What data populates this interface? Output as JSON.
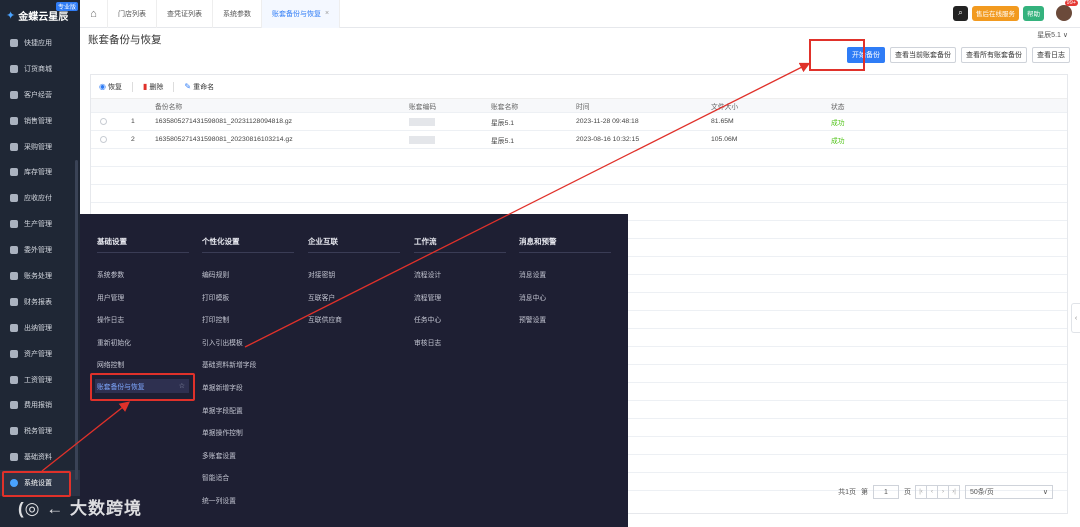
{
  "brand": {
    "name": "金蝶云星辰",
    "badge": "专业版"
  },
  "sidebar": {
    "items": [
      {
        "label": "快捷应用"
      },
      {
        "label": "订货商城"
      },
      {
        "label": "客户经营"
      },
      {
        "label": "销售管理"
      },
      {
        "label": "采购管理"
      },
      {
        "label": "库存管理"
      },
      {
        "label": "应收应付"
      },
      {
        "label": "生产管理"
      },
      {
        "label": "委外管理"
      },
      {
        "label": "账务处理"
      },
      {
        "label": "财务报表"
      },
      {
        "label": "出纳管理"
      },
      {
        "label": "资产管理"
      },
      {
        "label": "工资管理"
      },
      {
        "label": "费用报销"
      },
      {
        "label": "税务管理"
      },
      {
        "label": "基础资料"
      },
      {
        "label": "系统设置"
      }
    ],
    "active_index": 17
  },
  "tabs": [
    {
      "label": "门店列表"
    },
    {
      "label": "查凭证列表"
    },
    {
      "label": "系统参数"
    },
    {
      "label": "账套备份与恢复",
      "close": "×"
    }
  ],
  "topbar": {
    "service": "售后在线服务",
    "help": "帮助",
    "badge": "99+",
    "search_icon": "⌕",
    "home_icon": "⌂"
  },
  "page": {
    "title": "账套备份与恢复",
    "account": "星辰5.1 ∨",
    "buttons": {
      "start": "开始备份",
      "current": "查看当前账套备份",
      "all": "查看所有账套备份",
      "log": "查看日志"
    }
  },
  "toolbar": {
    "restore": "恢复",
    "delete": "删除",
    "rename": "重命名"
  },
  "table": {
    "headers": {
      "name": "备份名称",
      "code": "账套编码",
      "acct": "账套名称",
      "time": "时间",
      "size": "文件大小",
      "status": "状态"
    },
    "rows": [
      {
        "idx": "1",
        "name": "1635805271431598081_20231128094818.gz",
        "acct": "星辰5.1",
        "time": "2023-11-28 09:48:18",
        "size": "81.65M",
        "status": "成功"
      },
      {
        "idx": "2",
        "name": "1635805271431598081_20230816103214.gz",
        "acct": "星辰5.1",
        "time": "2023-08-16 10:32:15",
        "size": "105.06M",
        "status": "成功"
      }
    ]
  },
  "pager": {
    "total": "共1页",
    "page_prefix": "第",
    "page": "1",
    "page_suffix": "页",
    "size": "50条/页",
    "size_arrow": "∨",
    "first": "|‹",
    "prev": "‹",
    "next": "›",
    "last": "›|"
  },
  "mega": {
    "col1": {
      "head": "基础设置",
      "items": [
        "系统参数",
        "用户管理",
        "操作日志",
        "重新初始化",
        "网络控制"
      ],
      "selected": "账套备份与恢复",
      "star": "☆"
    },
    "col2": {
      "head": "个性化设置",
      "items": [
        "编码规则",
        "打印模板",
        "打印控制",
        "引入引出模板",
        "基础资料新增字段",
        "单据新增字段",
        "单据字段配置",
        "单据操作控制",
        "多账套设置",
        "智能适合",
        "统一列设置"
      ]
    },
    "col3": {
      "head": "企业互联",
      "items": [
        "对接密钥",
        "互联客户",
        "互联供应商"
      ]
    },
    "col4": {
      "head": "工作流",
      "items": [
        "流程设计",
        "流程管理",
        "任务中心",
        "审核日志"
      ]
    },
    "col5": {
      "head": "消息和预警",
      "items": [
        "消息设置",
        "消息中心",
        "预警设置"
      ]
    }
  },
  "watermark": "大数跨境",
  "colors": {
    "primary": "#2f7cf6",
    "highlight": "#e0312a",
    "success": "#52c41a",
    "sidebar": "#1f2735",
    "menu": "#1e1f33"
  }
}
